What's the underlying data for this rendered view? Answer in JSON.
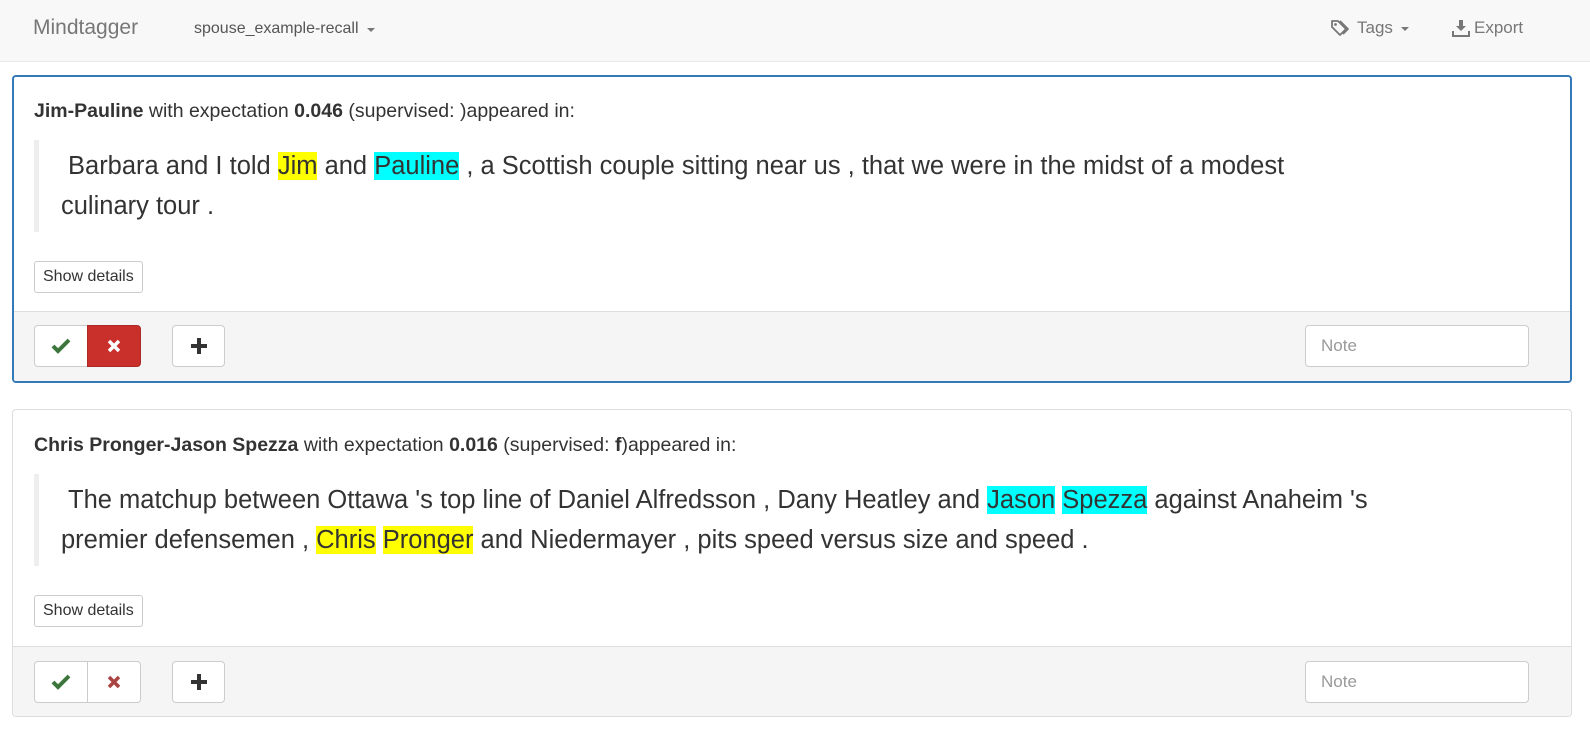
{
  "navbar": {
    "brand": "Mindtagger",
    "task": "spouse_example-recall",
    "tags_label": "Tags",
    "export_label": "Export"
  },
  "items": [
    {
      "pair": "Jim-Pauline",
      "with_text": " with expectation ",
      "expectation": "0.046",
      "supervised_prefix": " (supervised: ",
      "supervised_value": "",
      "supervised_suffix": ")appeared in:",
      "sentence": {
        "p1": "Barbara and I told ",
        "e1": "Jim",
        "p2": " and ",
        "e2": "Pauline",
        "p3": " , a Scottish couple sitting near us , that we were in the midst of a modest",
        "line2": "culinary tour ."
      },
      "details_label": "Show details",
      "note_placeholder": "Note",
      "label": "false"
    },
    {
      "pair": "Chris Pronger-Jason Spezza",
      "with_text": " with expectation ",
      "expectation": "0.016",
      "supervised_prefix": " (supervised: ",
      "supervised_value": "f",
      "supervised_suffix": ")appeared in:",
      "sentence": {
        "p1": "The matchup between Ottawa 's top line of Daniel Alfredsson , Dany Heatley and ",
        "e1": "Jason",
        "e2": "Spezza",
        "p2": " against Anaheim 's",
        "l2p1": "premier defensemen , ",
        "e3": "Chris",
        "e4": "Pronger",
        "l2p2": " and Niedermayer , pits speed versus size and speed ."
      },
      "details_label": "Show details",
      "note_placeholder": "Note",
      "label": "none"
    }
  ],
  "colors": {
    "highlight_person1": "#ffff00",
    "highlight_person2": "#00ffff",
    "active_border": "#337ab7",
    "danger": "#c9302c",
    "success": "#3c763d"
  },
  "icons": [
    "tags-icon",
    "download-icon",
    "checkmark-icon",
    "times-icon",
    "plus-icon"
  ]
}
